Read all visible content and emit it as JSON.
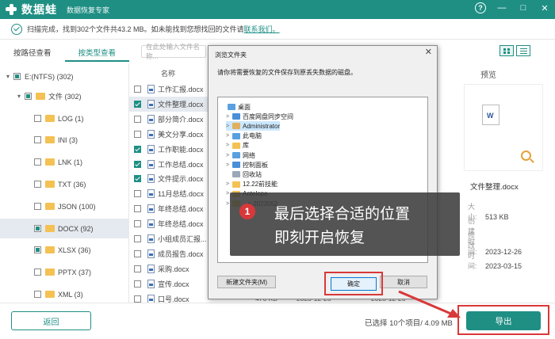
{
  "app": {
    "title": "数据蛙",
    "subtitle": "数据恢复专家",
    "brand_color": "#1f8f84",
    "accent_red": "#d9383a"
  },
  "window_controls": [
    {
      "icon": "help-icon",
      "label": "?"
    },
    {
      "icon": "minimize-icon",
      "label": "—"
    },
    {
      "icon": "restore-icon",
      "label": "□"
    },
    {
      "icon": "close-icon",
      "label": "✕"
    }
  ],
  "status": {
    "text": "扫描完成，找到302个文件共43.2 MB。如未能找到您想找回的文件请",
    "link": "联系我们。"
  },
  "tabs": [
    {
      "label": "按路径查看",
      "active": false
    },
    {
      "label": "按类型查看",
      "active": true
    }
  ],
  "search": {
    "placeholder": "在此处输入文件名称..."
  },
  "tree": [
    {
      "label": "E:(NTFS) (302)",
      "caret": "▾",
      "check": "part",
      "folder": false,
      "selected": false
    },
    {
      "label": "文件 (302)",
      "caret": "▾",
      "check": "part",
      "folder": true,
      "selected": false
    },
    {
      "label": "LOG (1)",
      "caret": "",
      "check": "none",
      "folder": true,
      "selected": false
    },
    {
      "label": "INI (3)",
      "caret": "",
      "check": "none",
      "folder": true,
      "selected": false
    },
    {
      "label": "LNK (1)",
      "caret": "",
      "check": "none",
      "folder": true,
      "selected": false
    },
    {
      "label": "TXT (36)",
      "caret": "",
      "check": "none",
      "folder": true,
      "selected": false
    },
    {
      "label": "JSON (100)",
      "caret": "",
      "check": "none",
      "folder": true,
      "selected": false
    },
    {
      "label": "DOCX (92)",
      "caret": "",
      "check": "part",
      "folder": true,
      "selected": true
    },
    {
      "label": "XLSX (36)",
      "caret": "",
      "check": "part",
      "folder": true,
      "selected": false
    },
    {
      "label": "PPTX (37)",
      "caret": "",
      "check": "none",
      "folder": true,
      "selected": false
    },
    {
      "label": "XML (3)",
      "caret": "",
      "check": "none",
      "folder": true,
      "selected": false
    }
  ],
  "file_list": {
    "name_header": "名称",
    "rows": [
      {
        "name": "工作汇报.docx",
        "checked": false,
        "selected": false
      },
      {
        "name": "文件整理.docx",
        "checked": true,
        "selected": true
      },
      {
        "name": "部分简介.docx",
        "checked": false,
        "selected": false
      },
      {
        "name": "美文分享.docx",
        "checked": false,
        "selected": false
      },
      {
        "name": "工作职能.docx",
        "checked": true,
        "selected": false
      },
      {
        "name": "工作总结.docx",
        "checked": true,
        "selected": false
      },
      {
        "name": "文件提示.docx",
        "checked": true,
        "selected": false
      },
      {
        "name": "11月总结.docx",
        "checked": false,
        "selected": false
      },
      {
        "name": "年终总结.docx",
        "checked": false,
        "selected": false
      },
      {
        "name": "年终总结.docx",
        "checked": false,
        "selected": false
      },
      {
        "name": "小组成员汇报...",
        "checked": false,
        "selected": false
      },
      {
        "name": "成员报告.docx",
        "checked": false,
        "selected": false
      },
      {
        "name": "采购.docx",
        "checked": false,
        "selected": false
      },
      {
        "name": "宣传.docx",
        "checked": false,
        "selected": false
      },
      {
        "name": "口号.docx",
        "checked": false,
        "selected": false
      }
    ],
    "last_row_cells": {
      "size": "476 KB",
      "date1": "2023-12-26",
      "date2": "2023-12-26"
    }
  },
  "preview": {
    "title": "预览",
    "file_name": "文件整理.docx",
    "meta": [
      {
        "label": "大小:",
        "value": "513 KB"
      },
      {
        "label": "创建时间:",
        "value": "2023-12-26"
      },
      {
        "label": "修改时间:",
        "value": "2023-03-15"
      }
    ]
  },
  "footer": {
    "back_label": "返回",
    "selected_info": "已选择 10个项目/ 4.09 MB",
    "export_label": "导出"
  },
  "dialog": {
    "title": "浏览文件夹",
    "close": "✕",
    "instruction": "请你将需要恢复的文件保存到原丢失数据的磁盘。",
    "tree": [
      {
        "label": "桌面",
        "caret": "",
        "indent": 0,
        "icon_color": "#5aa0e0",
        "highlight": false
      },
      {
        "label": "百度网盘同步空间",
        "caret": ">",
        "indent": 1,
        "icon_color": "#4a8fd8",
        "highlight": false
      },
      {
        "label": "Administrator",
        "caret": ">",
        "indent": 1,
        "icon_color": "#e0b060",
        "highlight": true
      },
      {
        "label": "此电脑",
        "caret": ">",
        "indent": 1,
        "icon_color": "#5aa0e0",
        "highlight": false
      },
      {
        "label": "库",
        "caret": ">",
        "indent": 1,
        "icon_color": "#f4c153",
        "highlight": false
      },
      {
        "label": "网络",
        "caret": ">",
        "indent": 1,
        "icon_color": "#5aa0e0",
        "highlight": false
      },
      {
        "label": "控制面板",
        "caret": ">",
        "indent": 1,
        "icon_color": "#4a8fd8",
        "highlight": false
      },
      {
        "label": "回收站",
        "caret": "",
        "indent": 1,
        "icon_color": "#9aa8b8",
        "highlight": false
      },
      {
        "label": "12.22前技能",
        "caret": ">",
        "indent": 1,
        "icon_color": "#f4c153",
        "highlight": false
      },
      {
        "label": "Antelope",
        "caret": ">",
        "indent": 1,
        "icon_color": "#f4c153",
        "highlight": false
      },
      {
        "label": "...s-2023052",
        "caret": ">",
        "indent": 1,
        "icon_color": "#f4c153",
        "highlight": false
      }
    ],
    "new_folder_label": "新建文件夹(M)",
    "ok_label": "确定",
    "cancel_label": "取消"
  },
  "callout": {
    "number": "1",
    "line1": "最后选择合适的位置",
    "line2": "即刻开启恢复"
  }
}
